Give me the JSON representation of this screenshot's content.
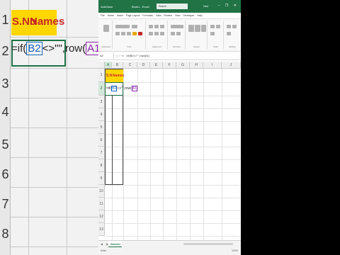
{
  "zoom": {
    "row_numbers": [
      "1",
      "2",
      "3",
      "4",
      "5",
      "6",
      "7",
      "8"
    ],
    "header_a": "S.No",
    "header_b": "Names",
    "formula_prefix": "=if(",
    "formula_ref1": "B2",
    "formula_mid": "<>\"\",row(",
    "formula_ref2": "A1"
  },
  "titlebar": {
    "logo": "AutoSave",
    "title": "Book1 - Excel",
    "search": "Search",
    "user": "User",
    "controls": "– ❐ ✕"
  },
  "menu": [
    "File",
    "Home",
    "Insert",
    "Page Layout",
    "Formulas",
    "Data",
    "Review",
    "View",
    "Developer",
    "Help"
  ],
  "ribbon_groups": [
    "Clipboard",
    "Font",
    "Alignment",
    "Number",
    "Styles",
    "Cells",
    "Editing"
  ],
  "formula_bar": {
    "name_box": "A2",
    "fx": "× ✓ fx",
    "value": "=if(B2<>\"\",row(A1)"
  },
  "columns": [
    "A",
    "B",
    "C",
    "D",
    "E",
    "F",
    "G",
    "H",
    "I",
    "J"
  ],
  "rows": [
    "1",
    "2",
    "3",
    "4",
    "5",
    "6",
    "7",
    "8",
    "9",
    "10",
    "11",
    "12",
    "13"
  ],
  "cells": {
    "a1": "S.No",
    "b1": "Names",
    "a2_prefix": "=if(",
    "a2_ref1": "B2",
    "a2_mid": "<>\"\",row(",
    "a2_ref2": "A1"
  },
  "sheet": {
    "nav": "◀ ▶",
    "tab": "Sheet1",
    "add": "+"
  },
  "status": {
    "left": "Enter",
    "zoom": "100%"
  },
  "colors": {
    "excel_green": "#217346",
    "header_yellow": "#ffd600",
    "header_text": "#c62828"
  }
}
